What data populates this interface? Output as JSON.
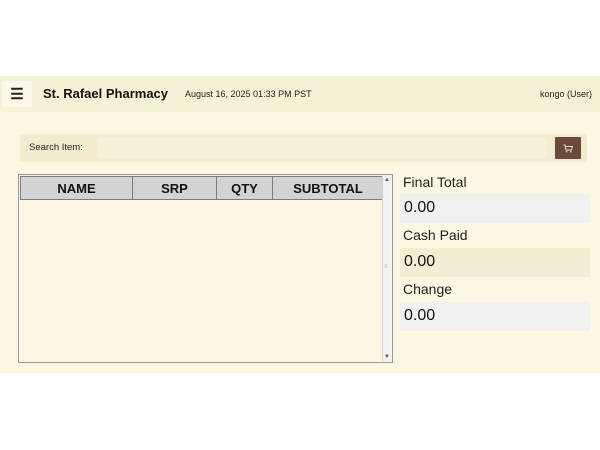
{
  "header": {
    "menu_icon": "hamburger-menu-icon",
    "title": "St. Rafael Pharmacy",
    "datetime": "August 16, 2025 01:33 PM PST",
    "user": "kongo (User)"
  },
  "search": {
    "label": "Search Item:",
    "value": "",
    "button_icon": "cart-icon"
  },
  "table": {
    "columns": [
      "NAME",
      "SRP",
      "QTY",
      "SUBTOTAL"
    ],
    "rows": []
  },
  "totals": {
    "final_total_label": "Final Total",
    "final_total_value": "0.00",
    "cash_paid_label": "Cash Paid",
    "cash_paid_value": "0.00",
    "change_label": "Change",
    "change_value": "0.00"
  },
  "colors": {
    "background": "#fbf7e3",
    "header": "#f5f1d4",
    "button": "#6b4a3a",
    "table_header": "#d3d3d3"
  }
}
